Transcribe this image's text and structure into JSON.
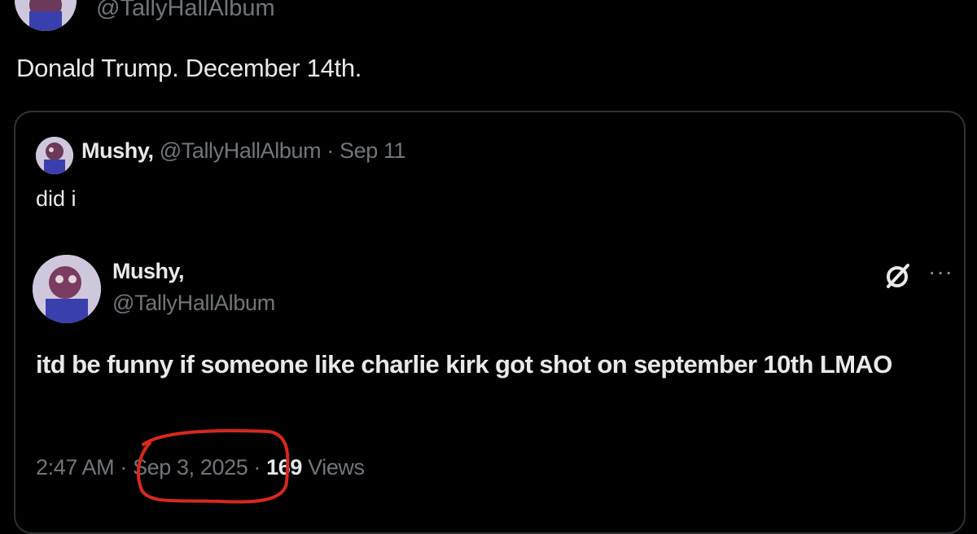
{
  "top": {
    "handle": "@TallyHallAlbum",
    "text": "Donald Trump. December 14th."
  },
  "quote": {
    "name": "Mushy,",
    "handle": "@TallyHallAlbum",
    "separator": "·",
    "date": "Sep 11",
    "text": "did i"
  },
  "embedded": {
    "name": "Mushy,",
    "handle": "@TallyHallAlbum",
    "body": "itd be funny if someone like charlie kirk got shot on september 10th LMAO",
    "time": "2:47 AM",
    "separator": "·",
    "date": "Sep 3, 2025",
    "views_count": "169",
    "views_label": "Views"
  },
  "icons": {
    "grok": "grok-icon",
    "more": "more-icon"
  },
  "colors": {
    "background": "#000000",
    "text": "#e7e9ea",
    "muted": "#71767b",
    "border": "#2f3336",
    "highlight": "#d9281c"
  }
}
